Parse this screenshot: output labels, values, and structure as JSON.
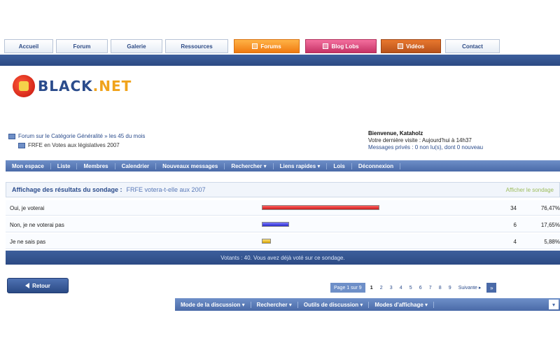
{
  "topnav": {
    "tabs": [
      {
        "label": "Accueil",
        "style": "normal"
      },
      {
        "label": "Forum",
        "style": "normal"
      },
      {
        "label": "Galerie",
        "style": "normal"
      },
      {
        "label": "Ressources",
        "style": "normal"
      },
      {
        "label": "Forums",
        "style": "forums"
      },
      {
        "label": "Blog Lobs",
        "style": "blog"
      },
      {
        "label": "Vidéos",
        "style": "videos"
      },
      {
        "label": "Contact",
        "style": "normal"
      }
    ]
  },
  "logo": {
    "text_main": "BLACK",
    "text_accent": ".NET"
  },
  "breadcrumb": {
    "line1": "Forum sur le Catégorie Généralité » les 45 du mois",
    "line2": "FRFE en Votes aux législatives 2007"
  },
  "welcome": {
    "name": "Bienvenue, Kataholz",
    "line2": "Votre dernière visite : Aujourd'hui à 14h37",
    "line3": "Messages privés : 0 non lu(s), dont 0 nouveau"
  },
  "subnav": {
    "items": [
      "Mon espace",
      "Liste",
      "Membres",
      "Calendrier",
      "Nouveaux messages",
      "Rechercher ▾",
      "Liens rapides ▾",
      "Lois",
      "Déconnexion"
    ]
  },
  "poll": {
    "title": "Affichage des résultats du sondage :",
    "question": "FRFE votera-t-elle aux 2007",
    "results_link": "Afficher le sondage",
    "options": [
      {
        "label": "Oui, je voterai",
        "votes": "34",
        "percent": "76,47%",
        "fraction": 0.7647,
        "color": "red"
      },
      {
        "label": "Non, je ne voterai pas",
        "votes": "6",
        "percent": "17,65%",
        "fraction": 0.1765,
        "color": "blue"
      },
      {
        "label": "Je ne sais pas",
        "votes": "4",
        "percent": "5,88%",
        "fraction": 0.0588,
        "color": "yellow"
      }
    ],
    "footer": "Votants : 40. Vous avez déjà voté sur ce sondage."
  },
  "controls": {
    "back_label": "Retour",
    "pager_label": "Page 1 sur 9",
    "pages": [
      "1",
      "2",
      "3",
      "4",
      "5",
      "6",
      "7",
      "8",
      "9"
    ],
    "next_label": "Suivante ▸",
    "end_label": "»"
  },
  "bottomnav": {
    "items": [
      "Mode de la discussion ▾",
      "Rechercher ▾",
      "Outils de discussion ▾",
      "Modes d'affichage ▾"
    ],
    "end_label": "▾"
  }
}
